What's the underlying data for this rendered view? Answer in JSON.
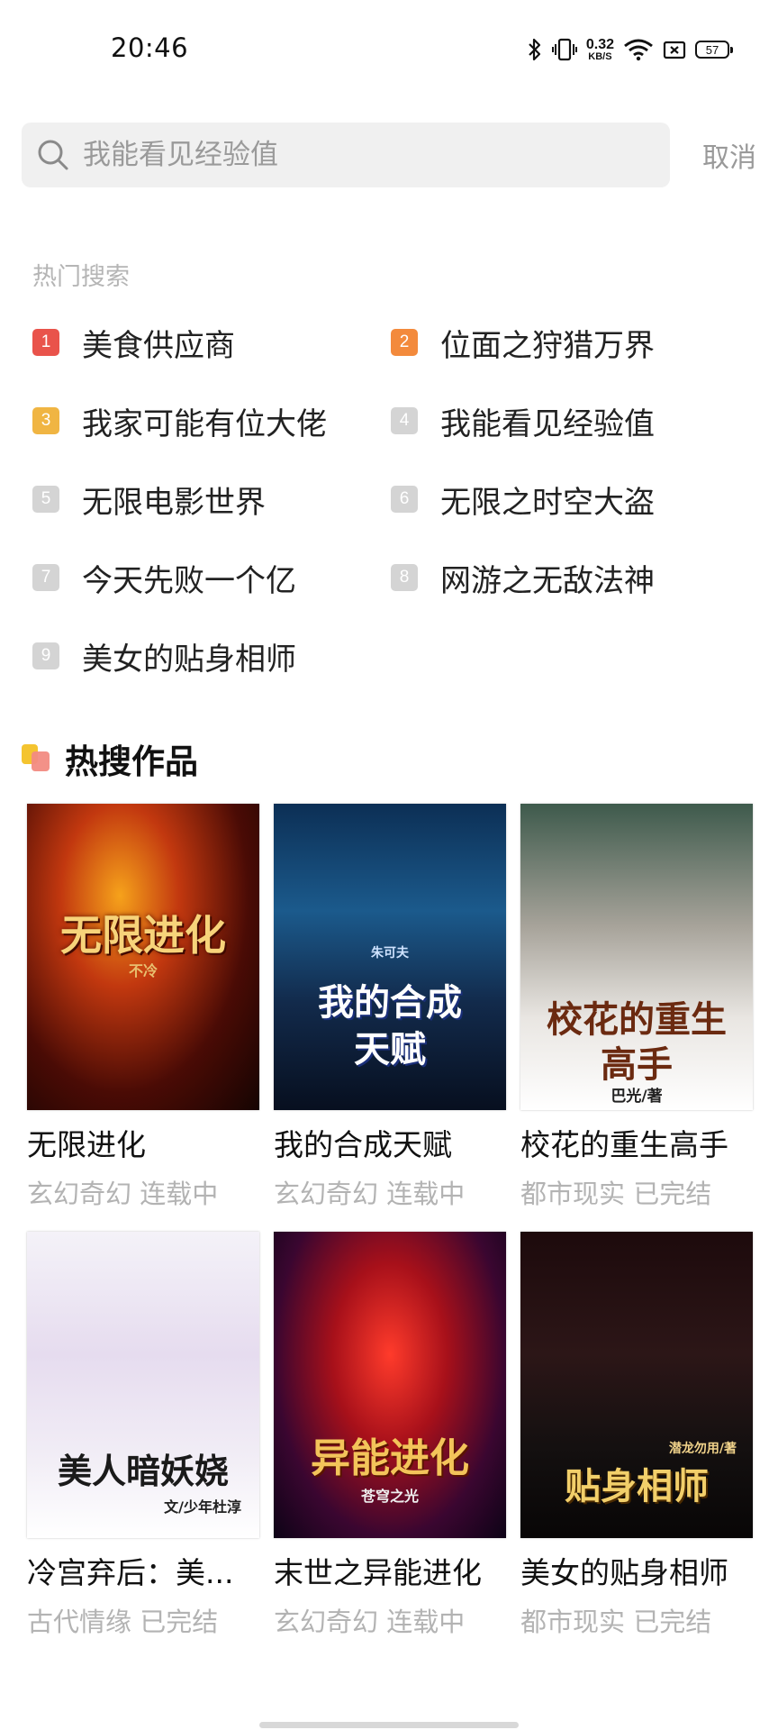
{
  "status_bar": {
    "time": "20:46",
    "net_speed_value": "0.32",
    "net_speed_unit": "KB/S",
    "battery": "57"
  },
  "search": {
    "placeholder": "我能看见经验值",
    "cancel_label": "取消"
  },
  "hot_search": {
    "title": "热门搜索",
    "items": [
      {
        "rank": "1",
        "text": "美食供应商"
      },
      {
        "rank": "2",
        "text": "位面之狩猎万界"
      },
      {
        "rank": "3",
        "text": "我家可能有位大佬"
      },
      {
        "rank": "4",
        "text": "我能看见经验值"
      },
      {
        "rank": "5",
        "text": "无限电影世界"
      },
      {
        "rank": "6",
        "text": "无限之时空大盗"
      },
      {
        "rank": "7",
        "text": "今天先败一个亿"
      },
      {
        "rank": "8",
        "text": "网游之无敌法神"
      },
      {
        "rank": "9",
        "text": "美女的贴身相师"
      }
    ]
  },
  "hot_works": {
    "title": "热搜作品",
    "books": [
      {
        "name": "无限进化",
        "category": "玄幻奇幻",
        "status": "连载中",
        "cover_text": "无限进化",
        "cover_author": "不冷"
      },
      {
        "name": "我的合成天赋",
        "category": "玄幻奇幻",
        "status": "连载中",
        "cover_text": "我的合成天赋",
        "cover_author": "朱可夫"
      },
      {
        "name": "校花的重生高手",
        "category": "都市现实",
        "status": "已完结",
        "cover_text": "校花的重生高手",
        "cover_author": "巴光/著"
      },
      {
        "name": "冷宫弃后：美...",
        "category": "古代情缘",
        "status": "已完结",
        "cover_text": "美人暗妖娆",
        "cover_author": "文/少年杜淳"
      },
      {
        "name": "末世之异能进化",
        "category": "玄幻奇幻",
        "status": "连载中",
        "cover_text": "异能进化",
        "cover_author": "苍穹之光"
      },
      {
        "name": "美女的贴身相师",
        "category": "都市现实",
        "status": "已完结",
        "cover_text": "贴身相师",
        "cover_author": "潜龙勿用/著"
      }
    ]
  },
  "icons": {
    "search": "search-icon",
    "bluetooth": "bluetooth-icon",
    "vibrate": "vibrate-icon",
    "wifi": "wifi-icon",
    "sim": "sim-icon",
    "battery": "battery-icon"
  }
}
